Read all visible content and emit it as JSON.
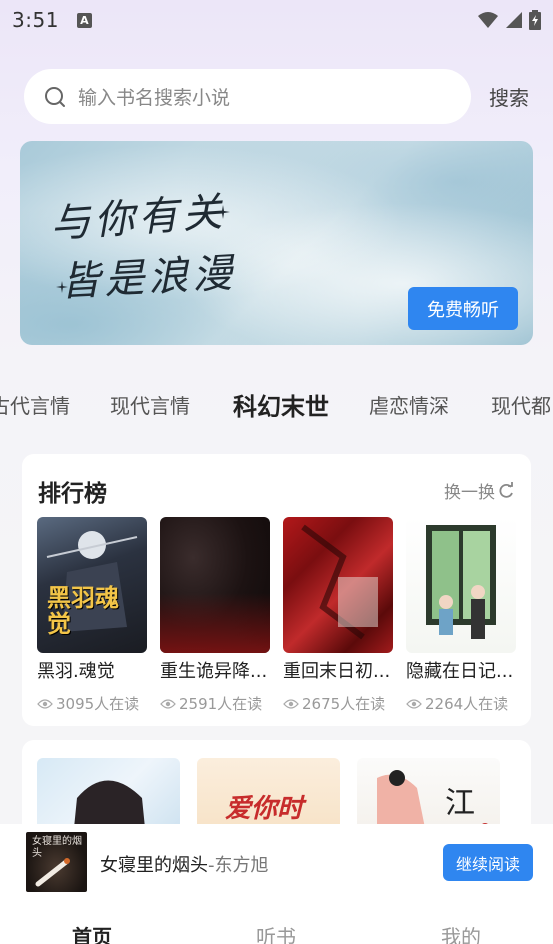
{
  "status_bar": {
    "time": "3:51",
    "notification_icon": "A"
  },
  "search": {
    "placeholder": "输入书名搜索小说",
    "button_label": "搜索"
  },
  "banner": {
    "line1": "与你有关",
    "line2": "皆是浪漫",
    "button_label": "免费畅听"
  },
  "categories": [
    {
      "label": "古代言情",
      "active": false
    },
    {
      "label": "现代言情",
      "active": false
    },
    {
      "label": "科幻末世",
      "active": true
    },
    {
      "label": "虐恋情深",
      "active": false
    },
    {
      "label": "现代都",
      "active": false
    }
  ],
  "ranking": {
    "title": "排行榜",
    "refresh_label": "换一换",
    "books": [
      {
        "title": "黑羽.魂觉",
        "readers": "3095人在读",
        "cover_text": "黑羽魂觉"
      },
      {
        "title": "重生诡异降...",
        "readers": "2591人在读"
      },
      {
        "title": "重回末日初...",
        "readers": "2675人在读"
      },
      {
        "title": "隐藏在日记...",
        "readers": "2264人在读"
      }
    ]
  },
  "recommend": {
    "cover2_text": "爱你时"
  },
  "now_reading": {
    "title": "女寝里的烟头",
    "author": "-东方旭",
    "cover_text": "女寝里的烟头",
    "button_label": "继续阅读"
  },
  "bottom_nav": [
    {
      "label": "首页",
      "active": true
    },
    {
      "label": "听书",
      "active": false
    },
    {
      "label": "我的",
      "active": false
    }
  ],
  "colors": {
    "accent": "#2f86f0"
  }
}
